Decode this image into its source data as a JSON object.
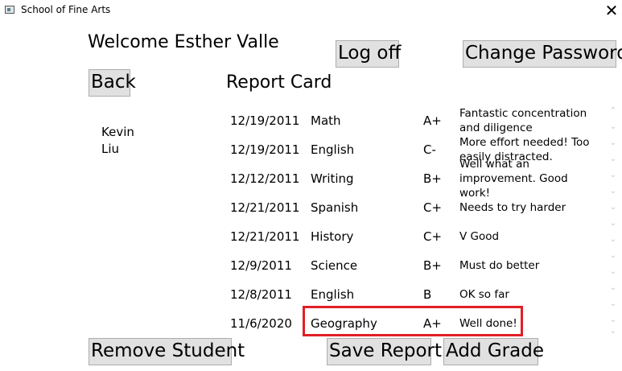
{
  "window": {
    "title": "School of Fine Arts",
    "close_glyph": "✕"
  },
  "header": {
    "welcome": "Welcome Esther Valle",
    "logoff_label": "Log off",
    "change_password_label": "Change Password",
    "back_label": "Back",
    "report_title": "Report Card"
  },
  "students": [
    "Kevin",
    "Liu"
  ],
  "report_rows": [
    {
      "date": "12/19/2011",
      "subject": "Math",
      "grade": "A+",
      "comment": "Fantastic concentration and diligence"
    },
    {
      "date": "12/19/2011",
      "subject": "English",
      "grade": "C-",
      "comment": "More effort needed! Too easily distracted."
    },
    {
      "date": "12/12/2011",
      "subject": "Writing",
      "grade": "B+",
      "comment": "Well what an improvement. Good work!"
    },
    {
      "date": "12/21/2011",
      "subject": "Spanish",
      "grade": "C+",
      "comment": "Needs to try harder"
    },
    {
      "date": "12/21/2011",
      "subject": "History",
      "grade": "C+",
      "comment": "V Good"
    },
    {
      "date": "12/9/2011",
      "subject": "Science",
      "grade": "B+",
      "comment": "Must do better"
    },
    {
      "date": "12/8/2011",
      "subject": "English",
      "grade": "B",
      "comment": "OK so far"
    },
    {
      "date": "11/6/2020",
      "subject": "Geography",
      "grade": "A+",
      "comment": "Well done!"
    }
  ],
  "footer": {
    "remove_student_label": "Remove Student",
    "save_report_label": "Save Report",
    "add_grade_label": "Add Grade"
  },
  "colors": {
    "highlight": "#e01f26",
    "button_bg": "#e1e1e1",
    "button_border": "#adadad"
  },
  "icons": {
    "app": "app-window-icon",
    "close": "close-icon",
    "scroll_down": "chevron-down-icon"
  }
}
